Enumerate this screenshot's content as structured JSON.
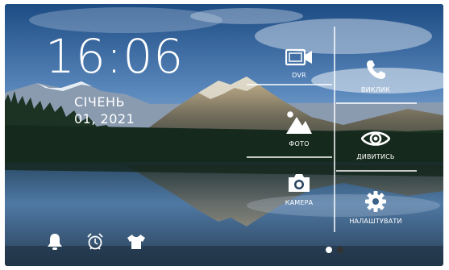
{
  "clock": {
    "time": "16:06",
    "month": "СІЧЕНЬ",
    "date": "01, 2021"
  },
  "tiles": [
    {
      "label": "DVR",
      "icon": "video-camera-icon"
    },
    {
      "label": "ФОТО",
      "icon": "image-icon"
    },
    {
      "label": "КАМЕРА",
      "icon": "camera-icon"
    },
    {
      "label": "ВИКЛИК",
      "icon": "phone-icon"
    },
    {
      "label": "ДИВИТИСЬ",
      "icon": "eye-icon"
    },
    {
      "label": "НАЛАШТУВАТИ",
      "icon": "gear-icon"
    }
  ],
  "bottom_icons": [
    "bell-icon",
    "alarm-clock-icon",
    "shirt-icon"
  ],
  "pager": {
    "pages": 2,
    "current": 1
  },
  "colors": {
    "text": "#ffffff",
    "divider": "#ffffff",
    "dot_active": "#ffffff",
    "dot_inactive": "#333333"
  }
}
